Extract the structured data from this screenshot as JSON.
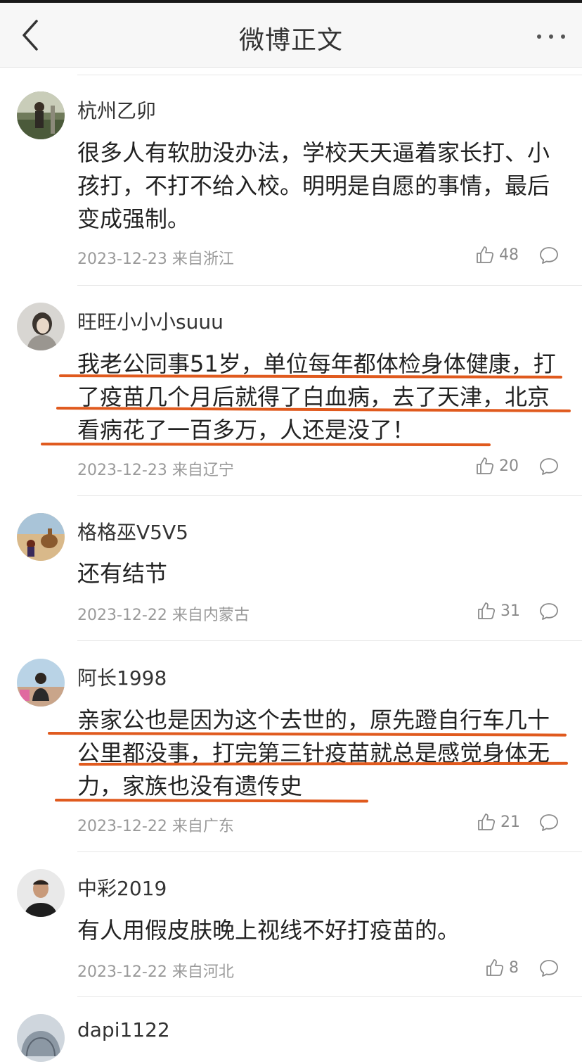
{
  "nav": {
    "title": "微博正文"
  },
  "comments": [
    {
      "username": "杭州乙卯",
      "text": "很多人有软肋没办法，学校天天逼着家长打、小孩打，不打不给入校。明明是自愿的事情，最后变成强制。",
      "date": "2023-12-23 来自浙江",
      "likes": "48"
    },
    {
      "username": "旺旺小小小suuu",
      "text": "我老公同事51岁，单位每年都体检身体健康，打了疫苗几个月后就得了白血病，去了天津，北京看病花了一百多万，人还是没了！",
      "date": "2023-12-23 来自辽宁",
      "likes": "20"
    },
    {
      "username": "格格巫V5V5",
      "text": "还有结节",
      "date": "2023-12-22 来自内蒙古",
      "likes": "31"
    },
    {
      "username": "阿长1998",
      "text": "亲家公也是因为这个去世的，原先蹬自行车几十公里都没事，打完第三针疫苗就总是感觉身体无力，家族也没有遗传史",
      "date": "2023-12-22 来自广东",
      "likes": "21"
    },
    {
      "username": "中彩2019",
      "text": "有人用假皮肤晚上视线不好打疫苗的。",
      "date": "2023-12-22 来自河北",
      "likes": "8"
    },
    {
      "username": "dapi1122"
    }
  ],
  "colors": {
    "underline": "#e05a1e",
    "meta": "#9a9a9a",
    "nav_bg": "#f7f7f7"
  },
  "icons": [
    "back-icon",
    "more-icon",
    "like-icon",
    "comment-icon"
  ]
}
